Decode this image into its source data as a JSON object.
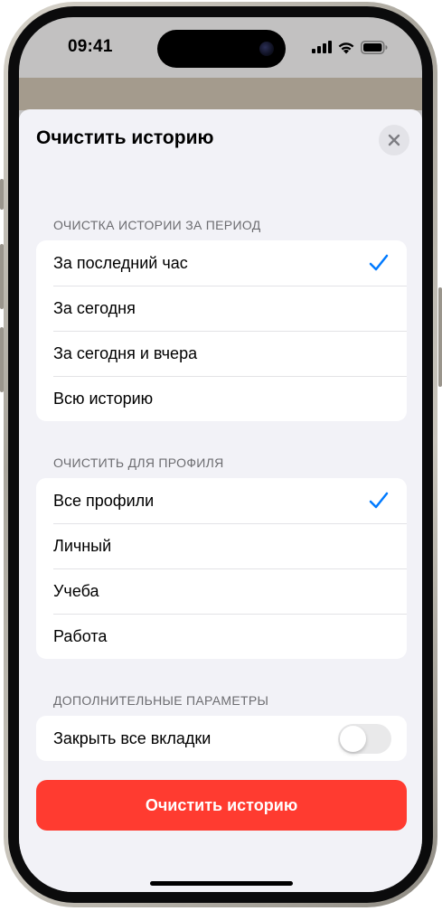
{
  "status_bar": {
    "time": "09:41"
  },
  "sheet": {
    "title": "Очистить историю",
    "close_icon": "xmark-icon",
    "period": {
      "header": "ОЧИСТКА ИСТОРИИ ЗА ПЕРИОД",
      "options": [
        {
          "label": "За последний час",
          "selected": true
        },
        {
          "label": "За сегодня",
          "selected": false
        },
        {
          "label": "За сегодня и вчера",
          "selected": false
        },
        {
          "label": "Всю историю",
          "selected": false
        }
      ]
    },
    "profile": {
      "header": "ОЧИСТИТЬ ДЛЯ ПРОФИЛЯ",
      "options": [
        {
          "label": "Все профили",
          "selected": true
        },
        {
          "label": "Личный",
          "selected": false
        },
        {
          "label": "Учеба",
          "selected": false
        },
        {
          "label": "Работа",
          "selected": false
        }
      ]
    },
    "extra": {
      "header": "ДОПОЛНИТЕЛЬНЫЕ ПАРАМЕТРЫ",
      "close_tabs": {
        "label": "Закрыть все вкладки",
        "on": false
      }
    },
    "clear_button": "Очистить историю"
  },
  "colors": {
    "accent": "#007aff",
    "destructive": "#ff3b30",
    "sheet_bg": "#f2f2f7"
  }
}
